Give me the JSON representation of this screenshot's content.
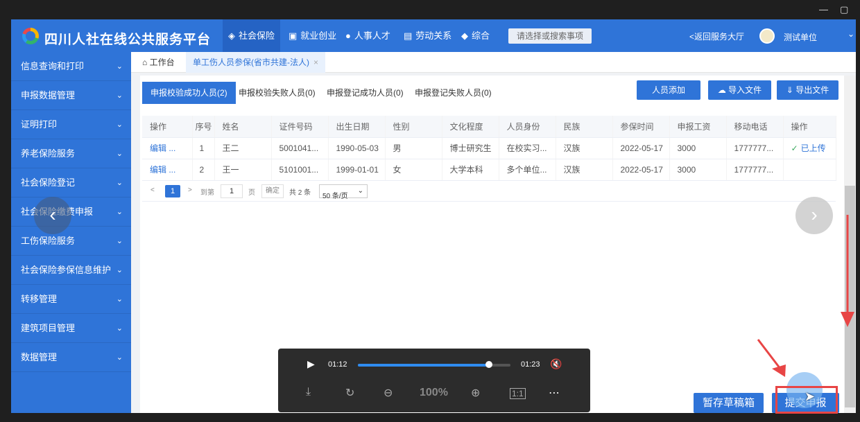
{
  "window": {
    "minimize_icon": "minimize-icon",
    "maximize_icon": "maximize-icon"
  },
  "header": {
    "title": "四川人社在线公共服务平台",
    "nav": [
      {
        "label": "社会保险",
        "icon": "shield-people-icon"
      },
      {
        "label": "就业创业",
        "icon": "briefcase-icon"
      },
      {
        "label": "人事人才",
        "icon": "people-icon"
      },
      {
        "label": "劳动关系",
        "icon": "document-icon"
      },
      {
        "label": "综合",
        "icon": "layers-icon"
      }
    ],
    "search_placeholder": "请选择或搜索事项",
    "back_label": "返回服务大厅",
    "user_name": "测试单位"
  },
  "sidebar": {
    "items": [
      {
        "label": "信息查询和打印"
      },
      {
        "label": "申报数据管理"
      },
      {
        "label": "证明打印"
      },
      {
        "label": "养老保险服务"
      },
      {
        "label": "社会保险登记"
      },
      {
        "label": "社会保险缴费申报"
      },
      {
        "label": "工伤保险服务"
      },
      {
        "label": "社会保险参保信息维护"
      },
      {
        "label": "转移管理"
      },
      {
        "label": "建筑项目管理"
      },
      {
        "label": "数据管理"
      }
    ]
  },
  "tabs": {
    "home": "工作台",
    "active": "单工伤人员参保(省市共建-法人)"
  },
  "subtabs": [
    {
      "label": "申报校验成功人员(2)"
    },
    {
      "label": "申报校验失败人员(0)"
    },
    {
      "label": "申报登记成功人员(0)"
    },
    {
      "label": "申报登记失败人员(0)"
    }
  ],
  "actions": {
    "add": "人员添加",
    "import": "导入文件",
    "export": "导出文件"
  },
  "table": {
    "headers": [
      "操作",
      "序号",
      "姓名",
      "证件号码",
      "出生日期",
      "性别",
      "文化程度",
      "人员身份",
      "民族",
      "参保时间",
      "申报工资",
      "移动电话",
      "操作"
    ],
    "rows": [
      [
        "编辑 ...",
        "1",
        "王二",
        "5001041...",
        "1990-05-03",
        "男",
        "博士研究生",
        "在校实习...",
        "汉族",
        "2022-05-17",
        "3000",
        "1777777...",
        "已上传"
      ],
      [
        "编辑 ...",
        "2",
        "王一",
        "5101001...",
        "1999-01-01",
        "女",
        "大学本科",
        "多个单位...",
        "汉族",
        "2022-05-17",
        "3000",
        "1777777...",
        ""
      ]
    ]
  },
  "pager": {
    "current": "1",
    "goto": "到第",
    "page_input": "1",
    "page_unit": "页",
    "confirm": "确定",
    "total": "共 2 条",
    "size": "50 条/页"
  },
  "footer": {
    "draft": "暂存草稿箱",
    "submit": "提交申报"
  },
  "player": {
    "current_time": "01:12",
    "duration": "01:23",
    "zoom": "100%",
    "progress_fraction": 0.86
  }
}
